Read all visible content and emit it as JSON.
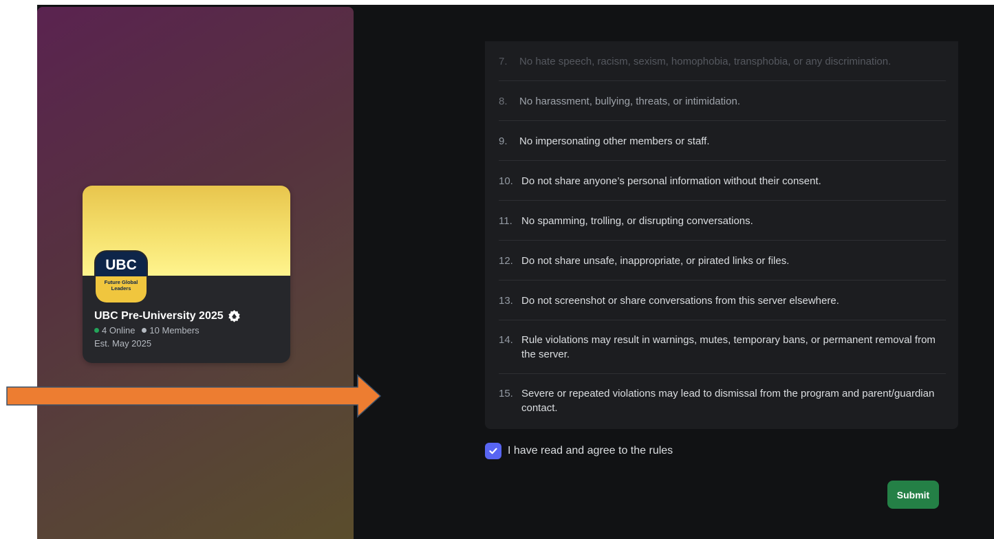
{
  "server_card": {
    "logo_title": "UBC",
    "logo_subtitle": "Future Global Leaders",
    "name": "UBC Pre-University 2025",
    "online": "4 Online",
    "members": "10 Members",
    "established": "Est. May 2025"
  },
  "rules": [
    {
      "num": "7.",
      "text": "No hate speech, racism, sexism, homophobia, transphobia, or any discrimination."
    },
    {
      "num": "8.",
      "text": "No harassment, bullying, threats, or intimidation."
    },
    {
      "num": "9.",
      "text": "No impersonating other members or staff."
    },
    {
      "num": "10.",
      "text": "Do not share anyone’s personal information without their consent."
    },
    {
      "num": "11.",
      "text": "No spamming, trolling, or disrupting conversations."
    },
    {
      "num": "12.",
      "text": "Do not share unsafe, inappropriate, or pirated links or files."
    },
    {
      "num": "13.",
      "text": "Do not screenshot or share conversations from this server elsewhere."
    },
    {
      "num": "14.",
      "text": "Rule violations may result in warnings, mutes, temporary bans, or permanent removal from the server."
    },
    {
      "num": "15.",
      "text": "Severe or repeated violations may lead to dismissal from the program and parent/guardian contact."
    }
  ],
  "agreement": {
    "label": "I have read and agree to the rules",
    "checked": true
  },
  "submit_label": "Submit",
  "colors": {
    "accent": "#5865f2",
    "submit": "#248046",
    "arrow": "#ed7d31",
    "online": "#23a55a"
  }
}
